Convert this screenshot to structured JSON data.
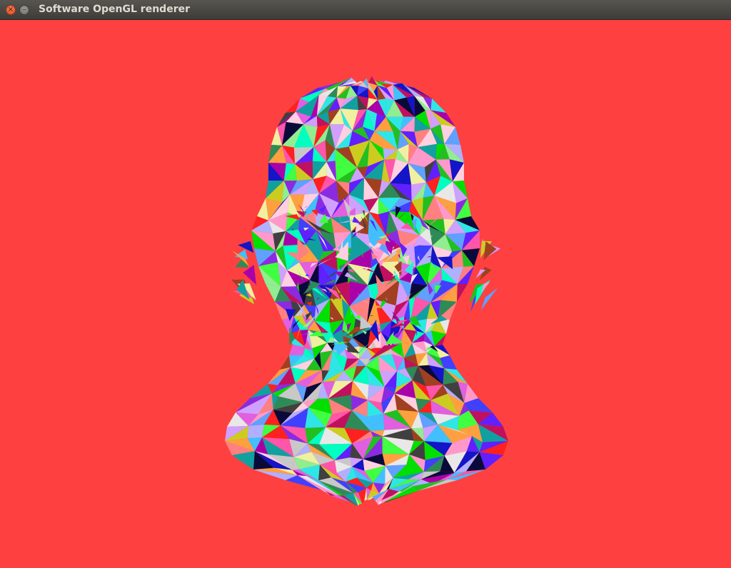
{
  "window": {
    "title": "Software OpenGL renderer",
    "close_glyph": "×",
    "minimize_glyph": "–"
  },
  "viewport": {
    "background_color": "#ff4040",
    "content": "low-poly head model rendered with random-colored flat triangles",
    "palette": [
      "#2ee6e6",
      "#20c020",
      "#ff55aa",
      "#8a2be2",
      "#1414c8",
      "#e8e8e8",
      "#ffa040",
      "#40ff40",
      "#b0b0ff",
      "#c8c8c8",
      "#2e8b57",
      "#f0f0a0",
      "#c01060",
      "#ff8080",
      "#60a0ff",
      "#0a0a3a",
      "#90ee90",
      "#aa00aa",
      "#00ffc0",
      "#cccc20",
      "#ff2020",
      "#6020ff",
      "#40c0ff",
      "#d0a0ff",
      "#404040",
      "#e060e0",
      "#10a0a0",
      "#ffd0e0",
      "#00e000",
      "#a04020",
      "#ff99cc",
      "#4040ff"
    ]
  }
}
